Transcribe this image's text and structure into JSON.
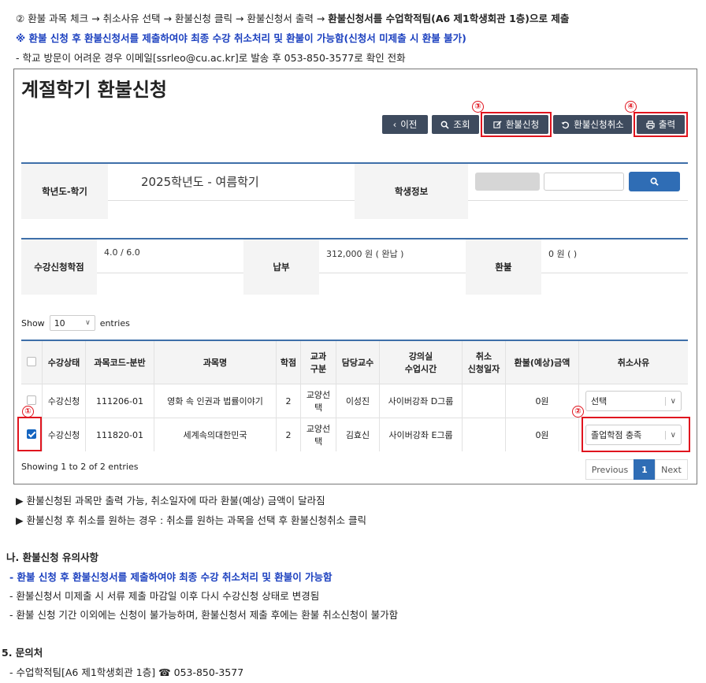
{
  "instructions": {
    "step2_num": "②",
    "step2": "환불 과목 체크 → 취소사유 선택 → 환불신청 클릭 → 환불신청서 출력 → ",
    "step2_bold": "환불신청서를 수업학적팀(A6 제1학생회관 1층)으로 제출",
    "note_blue": "※ 환불 신청 후 환불신청서를 제출하여야 최종 수강 취소처리 및 환불이 가능함(신청서 미제출 시 환불 불가)",
    "email_note": "- 학교 방문이 어려운 경우 이메일[ssrleo@cu.ac.kr]로 발송 후 053-850-3577로 확인 전화"
  },
  "screen": {
    "title": "계절학기 환불신청",
    "buttons": {
      "prev": "이전",
      "search": "조회",
      "apply": "환불신청",
      "cancel": "환불신청취소",
      "print": "출력"
    },
    "markers": {
      "m1": "①",
      "m2": "②",
      "m3": "③",
      "m4": "④"
    },
    "form": {
      "year_label": "학년도-학기",
      "year_value": "2025학년도 - 여름학기",
      "student_label": "학생정보",
      "credit_label": "수강신청학점",
      "credit_value": "4.0 / 6.0",
      "pay_label": "납부",
      "pay_value": "312,000 원 ( 완납 )",
      "refund_label": "환불",
      "refund_value": "0 원 ( )"
    },
    "show": {
      "prefix": "Show",
      "count": "10",
      "suffix": "entries"
    },
    "columns": [
      "",
      "수강상태",
      "과목코드-분반",
      "과목명",
      "학점",
      "교과\n구분",
      "담당교수",
      "강의실\n수업시간",
      "취소\n신청일자",
      "환불(예상)금액",
      "취소사유"
    ],
    "rows": [
      {
        "checked": false,
        "status": "수강신청",
        "code": "111206-01",
        "name": "영화 속 인권과 법률이야기",
        "credit": "2",
        "type": "교양선택",
        "prof": "이성진",
        "room": "사이버강좌 D그룹",
        "date": "",
        "amount": "0원",
        "reason": "선택"
      },
      {
        "checked": true,
        "status": "수강신청",
        "code": "111820-01",
        "name": "세계속의대한민국",
        "credit": "2",
        "type": "교양선택",
        "prof": "김효신",
        "room": "사이버강좌 E그룹",
        "date": "",
        "amount": "0원",
        "reason": "졸업학점 충족"
      }
    ],
    "footer": {
      "info": "Showing 1 to 2 of 2 entries",
      "previous": "Previous",
      "page": "1",
      "next": "Next"
    }
  },
  "notes_after": [
    "▶ 환불신청된 과목만 출력 가능, 취소일자에 따라 환불(예상) 금액이 달라짐",
    "▶ 환불신청 후 취소를 원하는 경우 : 취소를 원하는 과목을 선택 후 환불신청취소 클릭"
  ],
  "section_na": {
    "title": "나. 환불신청 유의사항",
    "item1": "- 환불 신청 후 환불신청서를 제출하여야 최종 수강 취소처리 및 환불이 가능함",
    "item2": "- 환불신청서 미제출 시 서류 제출 마감일 이후 다시 수강신청 상태로 변경됨",
    "item3": "- 환불 신청 기간 이외에는 신청이 불가능하며, 환불신청서 제출 후에는 환불 취소신청이 불가함"
  },
  "contact": {
    "title": "5. 문의처",
    "line": "- 수업학적팀[A6 제1학생회관 1층] ☎ 053-850-3577"
  },
  "colors": {
    "button_bg": "#3e4b5e",
    "highlight_red": "#e0141e",
    "accent_blue": "#3e6fa9",
    "search_btn": "#2f6db5"
  }
}
